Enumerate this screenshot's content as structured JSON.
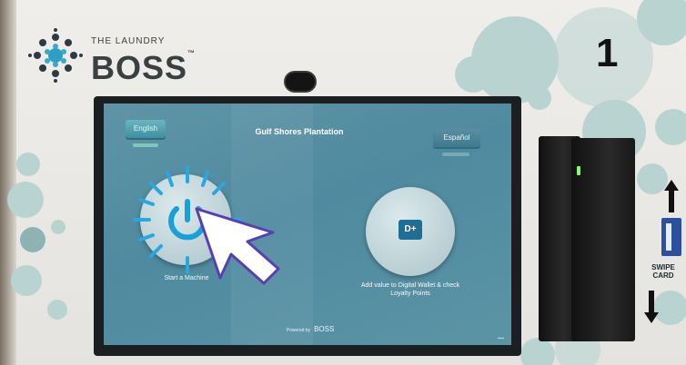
{
  "brand": {
    "small_text": "THE LAUNDRY",
    "big_text": "BOSS",
    "trademark": "™"
  },
  "step_number": "1",
  "screen": {
    "venue_title": "Gulf Shores Plantation",
    "language_left": "English",
    "language_right": "Español",
    "start_caption": "Start a Machine",
    "wallet_caption_line1": "Add value to Digital Wallet & check",
    "wallet_caption_line2": "Loyalty Points",
    "wallet_icon_text": "D+",
    "footer_powered": "Powered by",
    "footer_brand": "BOSS"
  },
  "card_reader": {
    "swipe_line1": "SWIPE",
    "swipe_line2": "CARD"
  },
  "colors": {
    "accent_teal": "#4f8aa0",
    "dot_teal": "#b9d3d1",
    "highlight_blue": "#2aa7e0"
  }
}
